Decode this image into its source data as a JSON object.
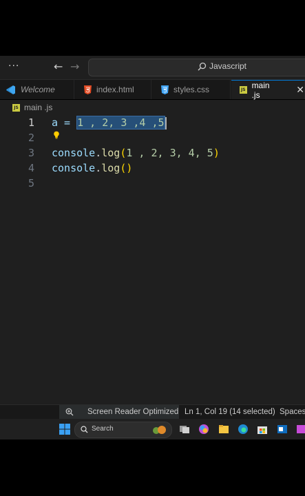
{
  "titlebar": {
    "more_label": "···",
    "back_label": "←",
    "forward_label": "→",
    "search_text": "Javascript"
  },
  "tabs": [
    {
      "label": "Welcome"
    },
    {
      "label": "index.html"
    },
    {
      "label": "styles.css"
    },
    {
      "label": "main .js",
      "close": "✕"
    }
  ],
  "breadcrumb": {
    "file": "main .js",
    "badge": "JS"
  },
  "editor": {
    "line_numbers": [
      "1",
      "2",
      "3",
      "4",
      "5"
    ],
    "line1_prefix": "a = ",
    "line1_selection": "1 , 2, 3 ,4 ,5",
    "line3": {
      "obj": "console",
      "dot": ".",
      "fn": "log",
      "open": "(",
      "args": "1 , 2, 3, 4, 5",
      "close": ")"
    },
    "line4": {
      "obj": "console",
      "dot": ".",
      "fn": "log",
      "open": "(",
      "close": ")"
    }
  },
  "status": {
    "screen_reader": "Screen Reader Optimized",
    "position": "Ln 1, Col 19 (14 selected)",
    "spaces": "Spaces:"
  },
  "taskbar": {
    "search_label": "Search"
  },
  "colors": {
    "accent": "#0078d4",
    "selection": "#264f78",
    "js_badge": "#cbcb41"
  }
}
